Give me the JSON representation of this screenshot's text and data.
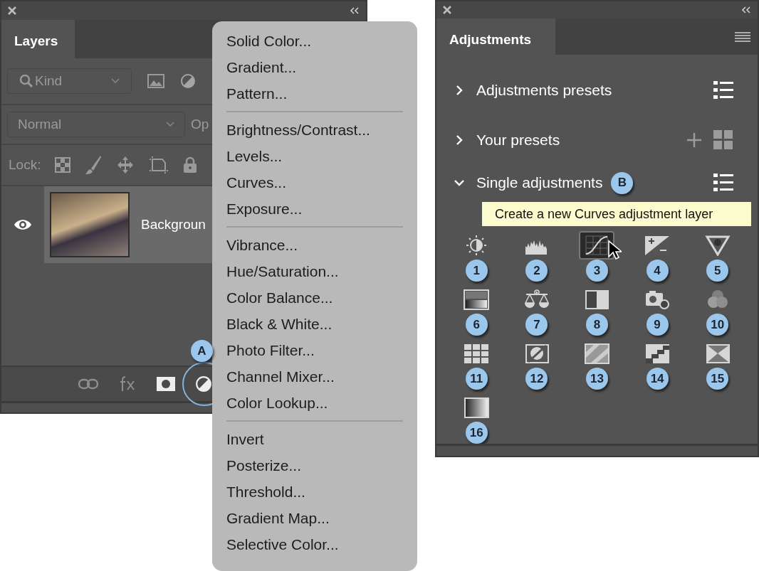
{
  "layers_panel": {
    "title": "Layers",
    "filter": {
      "value": "Kind"
    },
    "blend_mode": {
      "value": "Normal"
    },
    "opacity_label": "Op",
    "lock_label": "Lock:",
    "layers": [
      {
        "name": "Backgroun",
        "visible": true,
        "selected": true
      }
    ],
    "callout": "A"
  },
  "menu": {
    "groups": [
      [
        "Solid Color...",
        "Gradient...",
        "Pattern..."
      ],
      [
        "Brightness/Contrast...",
        "Levels...",
        "Curves...",
        "Exposure..."
      ],
      [
        "Vibrance...",
        "Hue/Saturation...",
        "Color Balance...",
        "Black & White...",
        "Photo Filter...",
        "Channel Mixer...",
        "Color Lookup..."
      ],
      [
        "Invert",
        "Posterize...",
        "Threshold...",
        "Gradient Map...",
        "Selective Color..."
      ]
    ]
  },
  "adjustments_panel": {
    "title": "Adjustments",
    "sections": [
      {
        "label": "Adjustments presets",
        "expanded": false,
        "kind": "list"
      },
      {
        "label": "Your presets",
        "expanded": false,
        "kind": "grid"
      },
      {
        "label": "Single adjustments",
        "expanded": true,
        "kind": "list",
        "callout": "B"
      }
    ],
    "tooltip": "Create a new Curves adjustment layer",
    "tools": [
      {
        "number": "1",
        "selected": false
      },
      {
        "number": "2",
        "selected": false
      },
      {
        "number": "3",
        "selected": true
      },
      {
        "number": "4",
        "selected": false
      },
      {
        "number": "5",
        "selected": false
      },
      {
        "number": "6",
        "selected": false
      },
      {
        "number": "7",
        "selected": false
      },
      {
        "number": "8",
        "selected": false
      },
      {
        "number": "9",
        "selected": false
      },
      {
        "number": "10",
        "selected": false
      },
      {
        "number": "11",
        "selected": false
      },
      {
        "number": "12",
        "selected": false
      },
      {
        "number": "13",
        "selected": false
      },
      {
        "number": "14",
        "selected": false
      },
      {
        "number": "15",
        "selected": false
      },
      {
        "number": "16",
        "selected": false
      }
    ]
  }
}
